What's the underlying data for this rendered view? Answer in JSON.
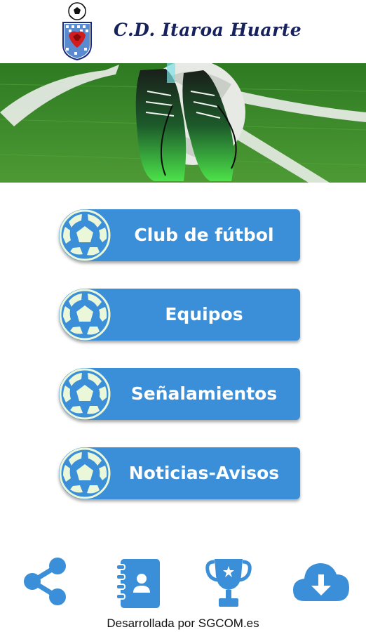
{
  "header": {
    "title": "C.D. Itaroa Huarte"
  },
  "menu": [
    {
      "label": "Club de fútbol"
    },
    {
      "label": "Equipos"
    },
    {
      "label": "Señalamientos"
    },
    {
      "label": "Noticias-Avisos"
    }
  ],
  "bottom_bar": [
    {
      "icon": "share-icon"
    },
    {
      "icon": "contacts-book-icon"
    },
    {
      "icon": "trophy-icon"
    },
    {
      "icon": "cloud-download-icon"
    }
  ],
  "footer": {
    "credit": "Desarrollada por SGCOM.es"
  },
  "colors": {
    "button": "#3a8fd8",
    "title": "#16215e",
    "grass": "#3f8a2c"
  }
}
